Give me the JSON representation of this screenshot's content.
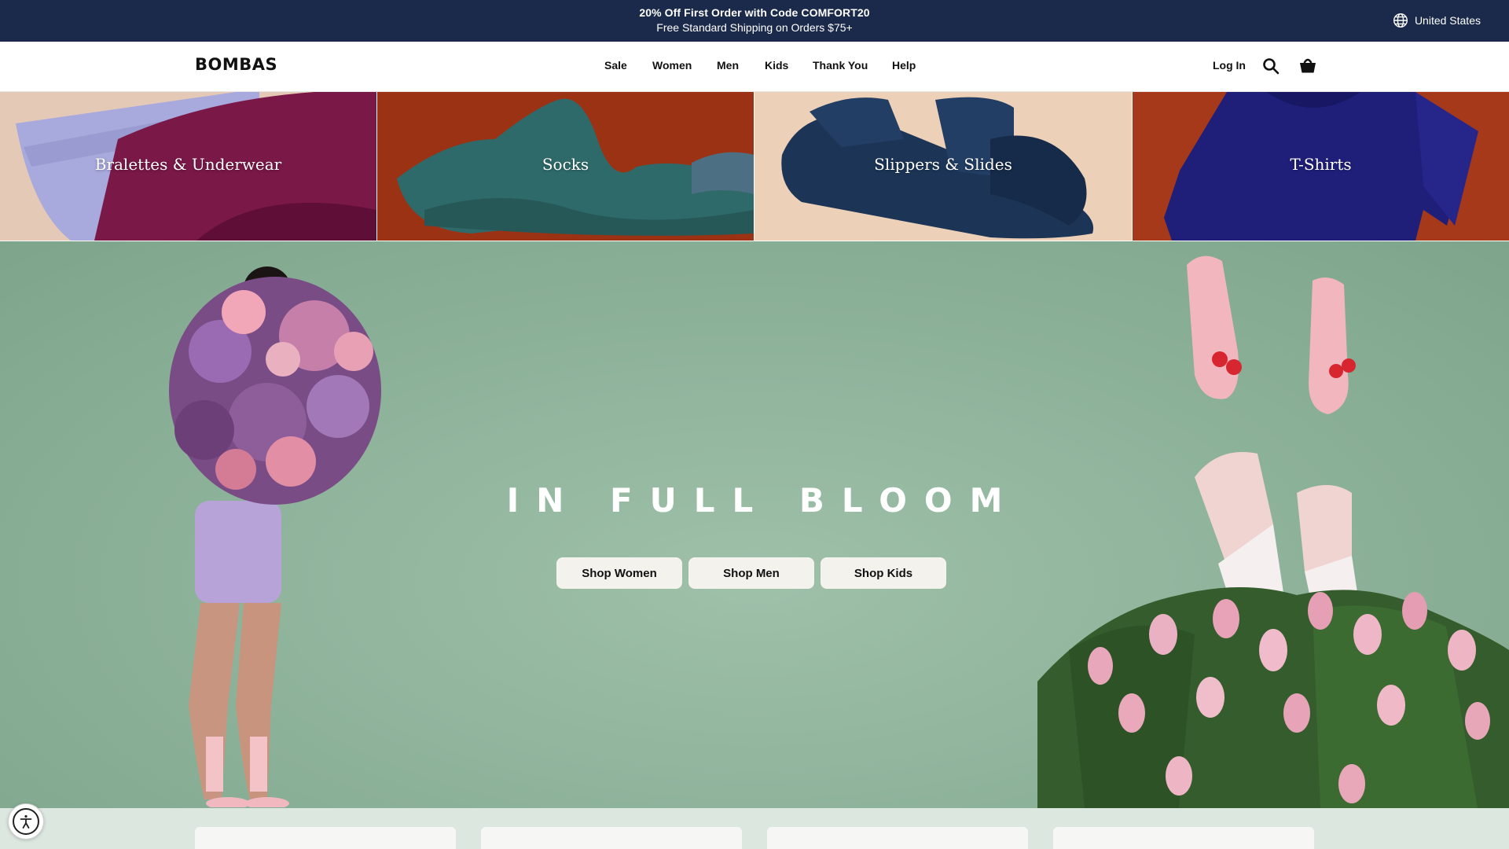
{
  "announcement": {
    "line1": "20% Off First Order with Code COMFORT20",
    "line2": "Free Standard Shipping on Orders $75+",
    "country": "United States"
  },
  "header": {
    "logo": "BOMBAS",
    "nav": [
      "Sale",
      "Women",
      "Men",
      "Kids",
      "Thank You",
      "Help"
    ],
    "login": "Log In",
    "icons": [
      "search-icon",
      "shopping-bag-icon"
    ]
  },
  "categories": [
    {
      "label": "Bralettes & Underwear"
    },
    {
      "label": "Socks"
    },
    {
      "label": "Slippers & Slides"
    },
    {
      "label": "T-Shirts"
    }
  ],
  "hero": {
    "title": "IN FULL BLOOM",
    "buttons": [
      "Shop Women",
      "Shop Men",
      "Shop Kids"
    ]
  },
  "colors": {
    "announcement_bg": "#1b2a4a",
    "hero_bg": "#8cb199",
    "button_bg": "#f4f2ec"
  },
  "accessibility": {
    "icon": "accessibility-icon"
  }
}
